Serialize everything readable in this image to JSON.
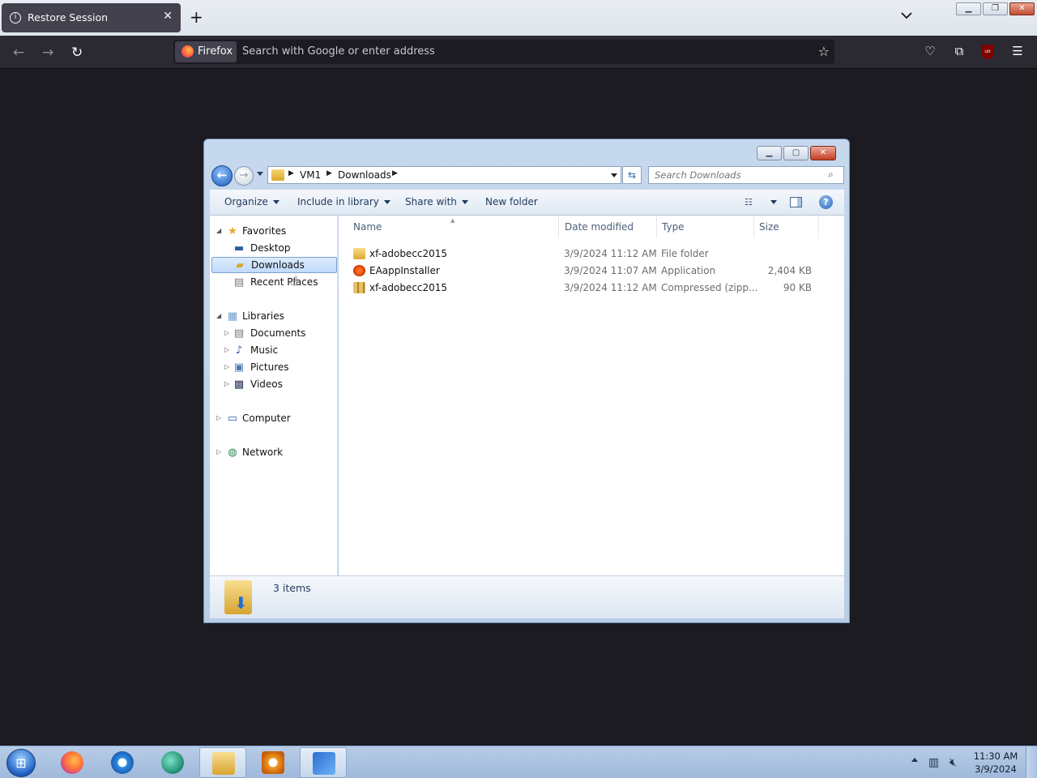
{
  "browser": {
    "tab_title": "Restore Session",
    "tab_close": "✕",
    "new_tab": "+",
    "identity_label": "Firefox",
    "url_placeholder": "Search with Google or enter address"
  },
  "explorer": {
    "breadcrumbs": [
      "VM1",
      "Downloads"
    ],
    "search_placeholder": "Search Downloads",
    "commands": {
      "organize": "Organize",
      "include_in_library": "Include in library",
      "share_with": "Share with",
      "new_folder": "New folder"
    },
    "nav": {
      "favorites": "Favorites",
      "desktop": "Desktop",
      "downloads": "Downloads",
      "recent_places": "Recent Places",
      "libraries": "Libraries",
      "documents": "Documents",
      "music": "Music",
      "pictures": "Pictures",
      "videos": "Videos",
      "computer": "Computer",
      "network": "Network"
    },
    "columns": {
      "name": "Name",
      "date_modified": "Date modified",
      "type": "Type",
      "size": "Size"
    },
    "files": [
      {
        "name": "xf-adobecc2015",
        "date": "3/9/2024 11:12 AM",
        "type": "File folder",
        "size": "",
        "icon": "folder-icon"
      },
      {
        "name": "EAappInstaller",
        "date": "3/9/2024 11:07 AM",
        "type": "Application",
        "size": "2,404 KB",
        "icon": "ea-app-icon"
      },
      {
        "name": "xf-adobecc2015",
        "date": "3/9/2024 11:12 AM",
        "type": "Compressed (zipp...",
        "size": "90 KB",
        "icon": "zip-icon"
      }
    ],
    "status": "3 items"
  },
  "taskbar": {
    "time": "11:30 AM",
    "date": "3/9/2024"
  },
  "colors": {
    "firefox_dark": "#2b2a33",
    "selection_blue": "#c1dbfc",
    "taskbar": "#b7cce6"
  }
}
